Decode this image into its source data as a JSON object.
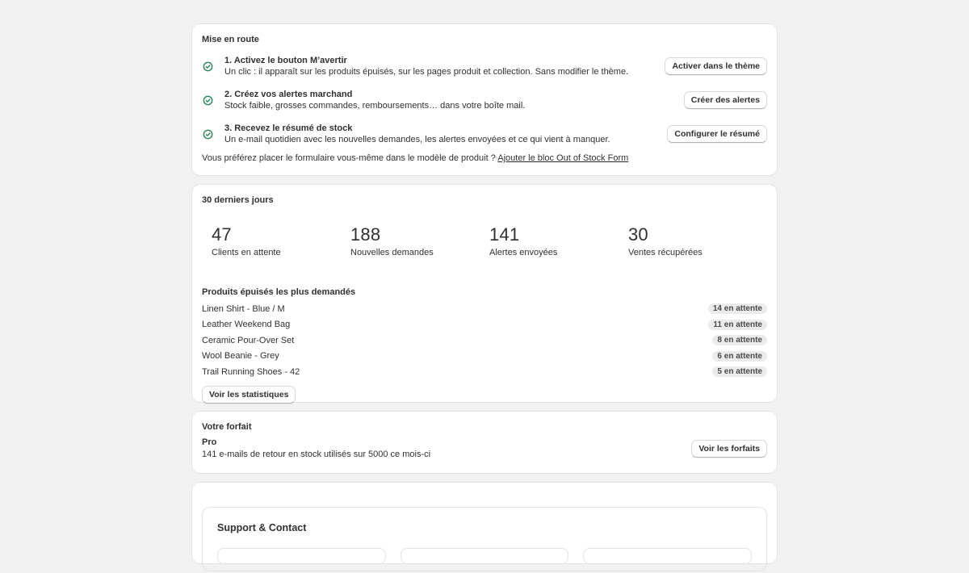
{
  "setup": {
    "title": "Mise en route",
    "steps": [
      {
        "title": "1. Activez le bouton M’avertir",
        "desc": "Un clic : il apparaît sur les produits épuisés, sur les pages produit et collection. Sans modifier le thème.",
        "button": "Activer dans le thème",
        "done": true
      },
      {
        "title": "2. Créez vos alertes marchand",
        "desc": "Stock faible, grosses commandes, remboursements… dans votre boîte mail.",
        "button": "Créer des alertes",
        "done": true
      },
      {
        "title": "3. Recevez le résumé de stock",
        "desc": "Un e-mail quotidien avec les nouvelles demandes, les alertes envoyées et ce qui vient à manquer.",
        "button": "Configurer le résumé",
        "done": true
      }
    ],
    "footnote_text": "Vous préférez placer le formulaire vous-même dans le modèle de produit ?",
    "footnote_link": "Ajouter le bloc Out of Stock Form"
  },
  "stats": {
    "title": "30 derniers jours",
    "metrics": [
      {
        "value": "47",
        "label": "Clients en attente"
      },
      {
        "value": "188",
        "label": "Nouvelles demandes"
      },
      {
        "value": "141",
        "label": "Alertes envoyées"
      },
      {
        "value": "30",
        "label": "Ventes récupérées"
      }
    ],
    "products_title": "Produits épuisés les plus demandés",
    "products": [
      {
        "name": "Linen Shirt - Blue / M",
        "badge": "14 en attente"
      },
      {
        "name": "Leather Weekend Bag",
        "badge": "11 en attente"
      },
      {
        "name": "Ceramic Pour-Over Set",
        "badge": "8 en attente"
      },
      {
        "name": "Wool Beanie - Grey",
        "badge": "6 en attente"
      },
      {
        "name": "Trail Running Shoes - 42",
        "badge": "5 en attente"
      }
    ],
    "button": "Voir les statistiques"
  },
  "plan": {
    "title": "Votre forfait",
    "name": "Pro",
    "usage": "141 e-mails de retour en stock utilisés sur 5000 ce mois-ci",
    "button": "Voir les forfaits"
  },
  "support": {
    "title": "Support & Contact"
  },
  "colors": {
    "background": "#f1f1f1",
    "card": "#ffffff",
    "check_green": "#29845a",
    "badge_bg": "#ebebeb"
  },
  "icons": {
    "step_done": "check-circle-icon"
  }
}
